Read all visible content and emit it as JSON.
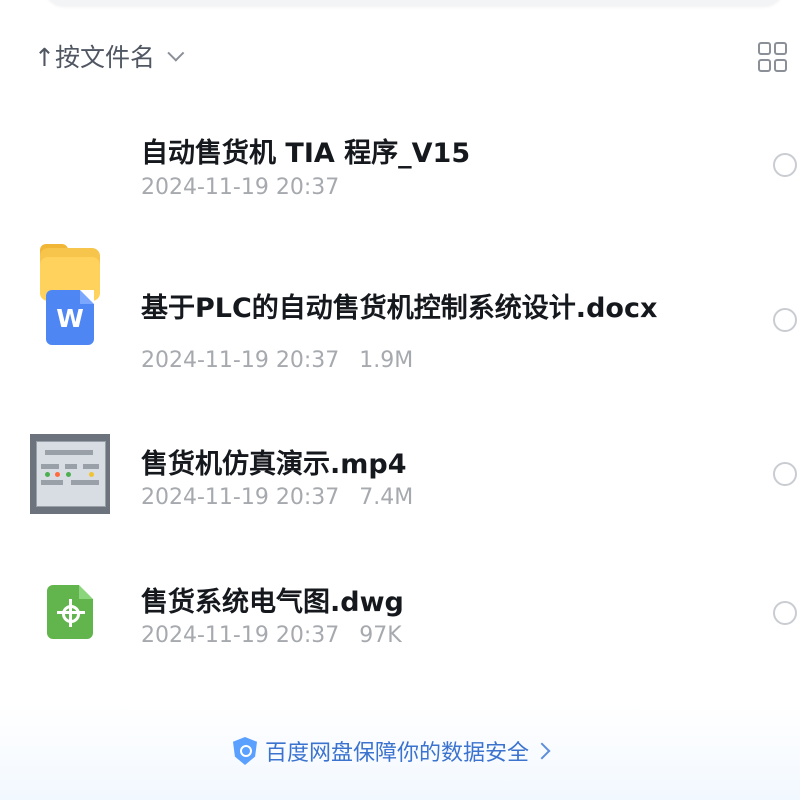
{
  "sort": {
    "label": "↑按文件名"
  },
  "files": [
    {
      "name": "自动售货机 TIA 程序_V15",
      "date": "2024-11-19 20:37",
      "size": ""
    },
    {
      "name": "基于PLC的自动售货机控制系统设计.docx",
      "date": "2024-11-19 20:37",
      "size": "1.9M"
    },
    {
      "name": "售货机仿真演示.mp4",
      "date": "2024-11-19 20:37",
      "size": "7.4M"
    },
    {
      "name": "售货系统电气图.dwg",
      "date": "2024-11-19 20:37",
      "size": "97K"
    }
  ],
  "footer": {
    "security_text": "百度网盘保障你的数据安全"
  },
  "colors": {
    "folder": "#f7c54c",
    "word": "#4e86f4",
    "dwg": "#62b44d",
    "security": "#3b73cf"
  },
  "icons": {
    "sort": "sort-icon",
    "view": "grid-view-icon",
    "folder": "folder-icon",
    "word": "word-icon",
    "video": "video-thumbnail-icon",
    "dwg": "dwg-icon",
    "shield": "shield-icon"
  }
}
